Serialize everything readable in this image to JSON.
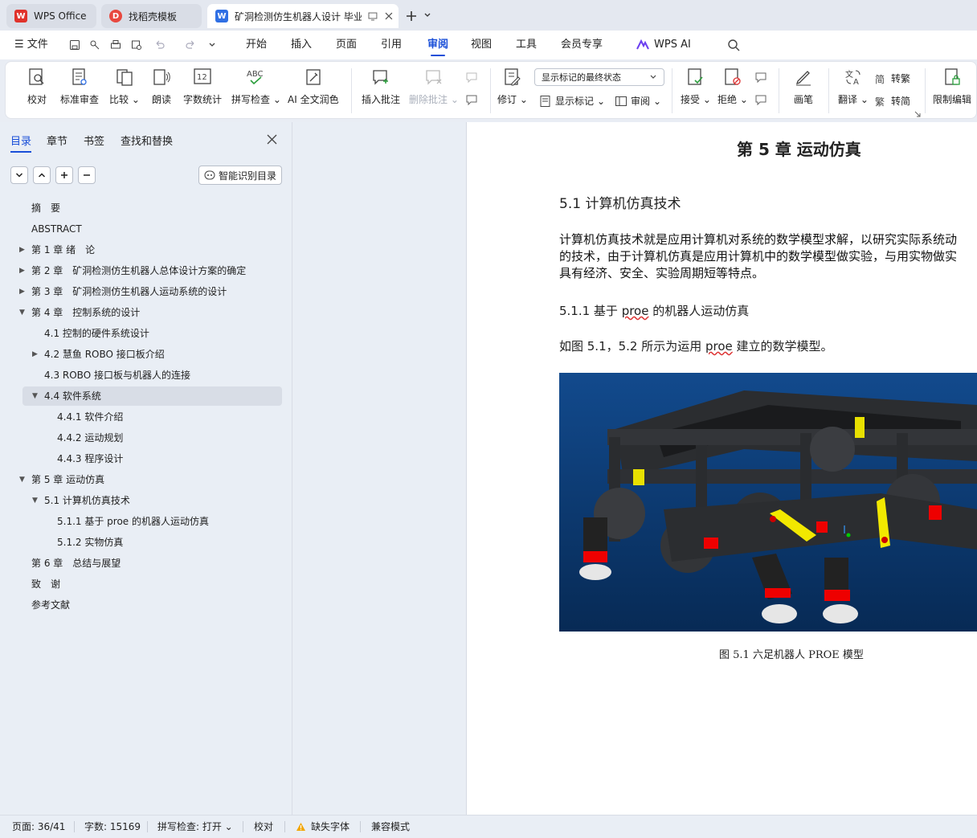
{
  "tabs": [
    {
      "label": "WPS Office",
      "icon": "wps-logo-icon"
    },
    {
      "label": "找稻壳模板",
      "icon": "docer-logo-icon"
    },
    {
      "label": "矿洞检测仿生机器人设计 毕业",
      "icon": "writer-logo-icon"
    }
  ],
  "menubar": {
    "file": "文件",
    "items": [
      "开始",
      "插入",
      "页面",
      "引用",
      "审阅",
      "视图",
      "工具",
      "会员专享"
    ],
    "active": "审阅",
    "wps_ai": "WPS AI"
  },
  "ribbon": {
    "proofread": "校对",
    "standard_review": "标准审查",
    "compare": "比较",
    "read_aloud": "朗读",
    "word_count": "字数统计",
    "spell_check": "拼写检查",
    "ai_polish": "AI 全文润色",
    "insert_comment": "插入批注",
    "delete_comment": "删除批注",
    "track_changes": "修订",
    "markup_select": "显示标记的最终状态",
    "show_markup": "显示标记",
    "review": "审阅",
    "accept": "接受",
    "reject": "拒绝",
    "pen": "画笔",
    "translate": "翻译",
    "to_traditional": "转繁",
    "to_simplified": "转简",
    "restrict_edit": "限制编辑"
  },
  "nav": {
    "tabs": [
      "目录",
      "章节",
      "书签",
      "查找和替换"
    ],
    "smart_toc": "智能识别目录",
    "toc": [
      {
        "label": "摘　要",
        "level": 1,
        "arrow": ""
      },
      {
        "label": "ABSTRACT",
        "level": 1,
        "arrow": ""
      },
      {
        "label": "第 1 章  绪　论",
        "level": 1,
        "arrow": "right"
      },
      {
        "label": "第 2 章　矿洞检测仿生机器人总体设计方案的确定",
        "level": 1,
        "arrow": "right"
      },
      {
        "label": "第 3 章　矿洞检测仿生机器人运动系统的设计",
        "level": 1,
        "arrow": "right"
      },
      {
        "label": "第 4 章　控制系统的设计",
        "level": 1,
        "arrow": "down"
      },
      {
        "label": "4.1 控制的硬件系统设计",
        "level": 2,
        "arrow": ""
      },
      {
        "label": "4.2 慧鱼  ROBO 接口板介绍",
        "level": 2,
        "arrow": "right"
      },
      {
        "label": "4.3 ROBO 接口板与机器人的连接",
        "level": 2,
        "arrow": ""
      },
      {
        "label": "4.4 软件系统",
        "level": 2,
        "arrow": "down",
        "selected": true
      },
      {
        "label": "4.4.1 软件介绍",
        "level": 3,
        "arrow": ""
      },
      {
        "label": "4.4.2 运动规划",
        "level": 3,
        "arrow": ""
      },
      {
        "label": "4.4.3 程序设计",
        "level": 3,
        "arrow": ""
      },
      {
        "label": "第 5 章  运动仿真",
        "level": 1,
        "arrow": "down"
      },
      {
        "label": "5.1 计算机仿真技术",
        "level": 2,
        "arrow": "down"
      },
      {
        "label": "5.1.1 基于 proe 的机器人运动仿真",
        "level": 3,
        "arrow": ""
      },
      {
        "label": "5.1.2 实物仿真",
        "level": 3,
        "arrow": ""
      },
      {
        "label": "第 6 章　总结与展望",
        "level": 1,
        "arrow": ""
      },
      {
        "label": "致　谢",
        "level": 1,
        "arrow": ""
      },
      {
        "label": "参考文献",
        "level": 1,
        "arrow": ""
      }
    ]
  },
  "document": {
    "chapter_title": "第 5 章  运动仿真",
    "section_title": "5.1 计算机仿真技术",
    "para_lines": [
      "计算机仿真技术就是应用计算机对系统的数学模型求解，以研究实际系统动",
      "的技术，由于计算机仿真是应用计算机中的数学模型做实验，与用实物做实",
      "具有经济、安全、实验周期短等特点。"
    ],
    "subsection_prefix": "5.1.1 基于 ",
    "subsection_proe": "proe",
    "subsection_suffix": " 的机器人运动仿真",
    "sentence_prefix": "如图 5.1，5.2 所示为运用 ",
    "sentence_proe": "proe",
    "sentence_suffix": " 建立的数学模型。",
    "figure_caption": "图 5.1  六足机器人 PROE 模型"
  },
  "status": {
    "page": "页面: 36/41",
    "word_count": "字数: 15169",
    "spell_check": "拼写检查: 打开",
    "proofread": "校对",
    "missing_font": "缺失字体",
    "compat_mode": "兼容模式"
  },
  "colors": {
    "accent": "#1a4fd8",
    "wps_red": "#e0322b",
    "writer_blue": "#2f6fe4",
    "figure_bg": "#0e3f7d"
  }
}
